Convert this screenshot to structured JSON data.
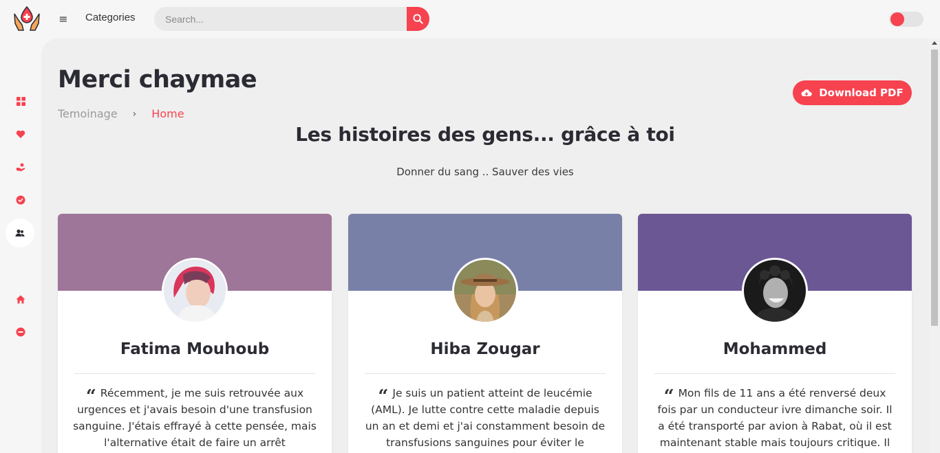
{
  "header": {
    "categories_label": "Categories",
    "search_placeholder": "Search..."
  },
  "page": {
    "title": "Merci chaymae",
    "breadcrumb": [
      "Temoinage",
      "Home"
    ],
    "download_label": "Download PDF",
    "headline": "Les histoires des gens... grâce à toi",
    "subline": "Donner du sang .. Sauver des vies"
  },
  "colors": {
    "accent": "#f7424f",
    "card1_header": "#9e7699",
    "card2_header": "#7980a8",
    "card3_header": "#6c5795"
  },
  "sidebar": {
    "icons": [
      "dashboard-icon",
      "heart-icon",
      "donate-hand-icon",
      "verified-icon",
      "users-icon",
      "home-icon",
      "minus-circle-icon"
    ]
  },
  "testimonials": [
    {
      "name": "Fatima Mouhoub",
      "text": "Récemment, je me suis retrouvée aux urgences et j'avais besoin d'une transfusion sanguine. J'étais effrayé à cette pensée, mais l'alternative était de faire un arrêt"
    },
    {
      "name": "Hiba Zougar",
      "text": "Je suis un patient atteint de leucémie (AML). Je lutte contre cette maladie depuis un an et demi et j'ai constamment besoin de transfusions sanguines pour éviter le"
    },
    {
      "name": "Mohammed",
      "text": "Mon fils de 11 ans a été renversé deux fois par un conducteur ivre dimanche soir. Il a été transporté par avion à Rabat, où il est maintenant stable mais toujours critique. Il"
    }
  ]
}
